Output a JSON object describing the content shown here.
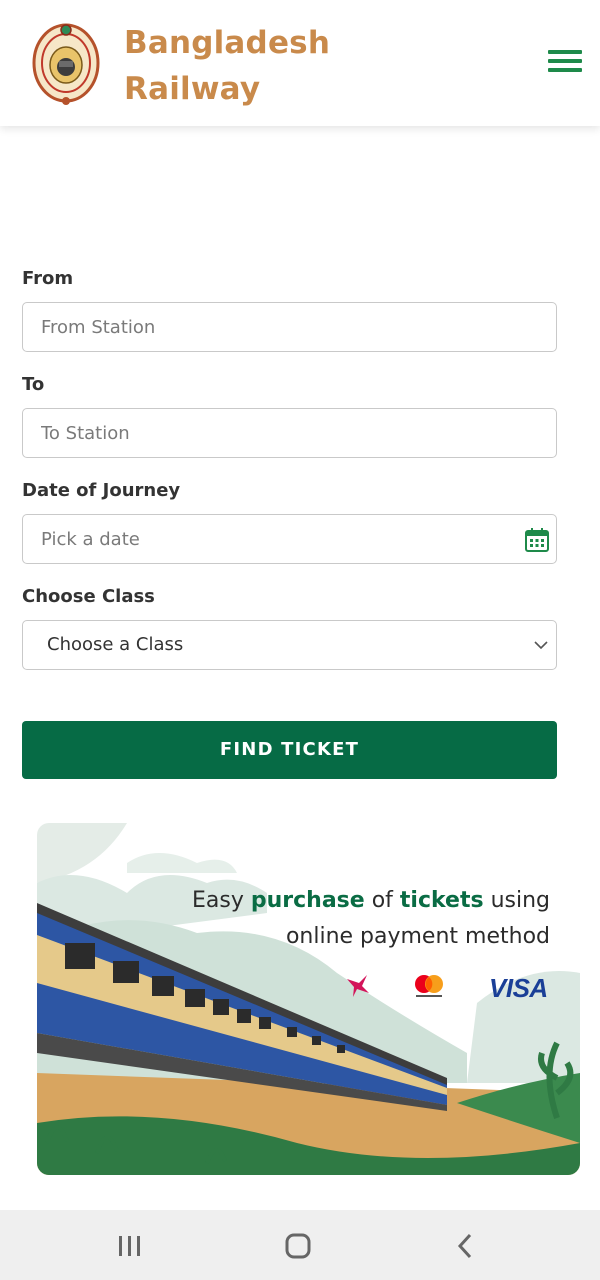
{
  "header": {
    "brand_line1": "Bangladesh",
    "brand_line2": "Railway",
    "logo_icon": "bangladesh-railway-emblem",
    "menu_icon": "hamburger-menu-icon"
  },
  "form": {
    "from_label": "From",
    "from_placeholder": "From Station",
    "to_label": "To",
    "to_placeholder": "To Station",
    "date_label": "Date of Journey",
    "date_placeholder": "Pick a date",
    "class_label": "Choose Class",
    "class_selected": "Choose a Class",
    "submit_label": "FIND TICKET"
  },
  "banner": {
    "text_pre": "Easy ",
    "text_em1": "purchase",
    "text_mid": " of ",
    "text_em2": "tickets",
    "text_post": " using",
    "text_line2": "online payment method",
    "payment_visa": "VISA",
    "payment_icons": [
      "bkash-icon",
      "mastercard-icon",
      "visa-logo"
    ]
  },
  "colors": {
    "brand": "#c98a4b",
    "accent": "#066b45",
    "menu": "#1e8a4a"
  },
  "system_nav": {
    "icons": [
      "recent-apps-icon",
      "home-icon",
      "back-icon"
    ]
  }
}
